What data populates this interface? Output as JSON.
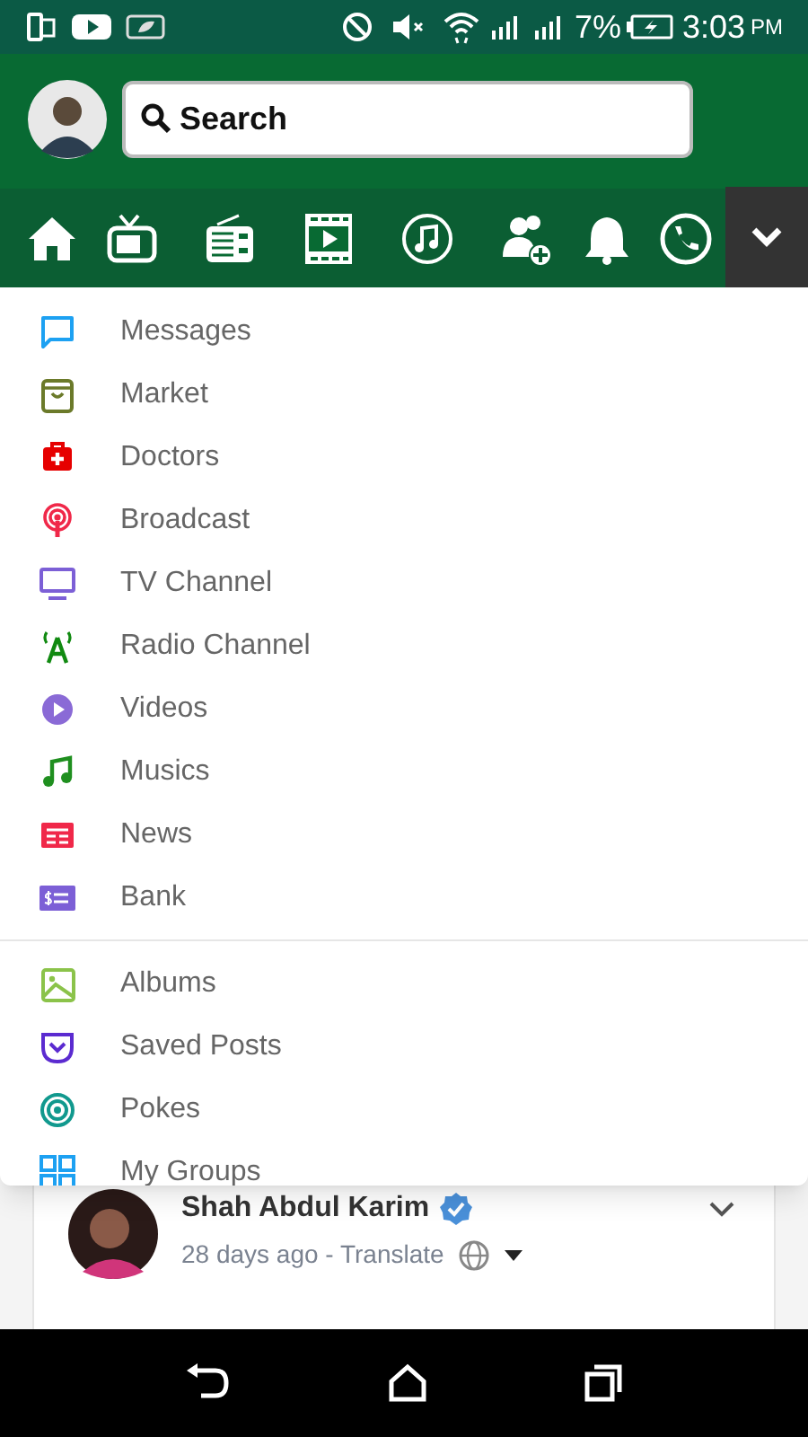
{
  "status_bar": {
    "battery": "7%",
    "time": "3:03",
    "ampm": "PM"
  },
  "search": {
    "placeholder": "Search"
  },
  "menu_toggle": {
    "expanded": true
  },
  "menu": {
    "groups": [
      {
        "items": [
          {
            "label": "Messages"
          },
          {
            "label": "Market"
          },
          {
            "label": "Doctors"
          },
          {
            "label": "Broadcast"
          },
          {
            "label": "TV Channel"
          },
          {
            "label": "Radio Channel"
          },
          {
            "label": "Videos"
          },
          {
            "label": "Musics"
          },
          {
            "label": "News"
          },
          {
            "label": "Bank"
          }
        ]
      },
      {
        "items": [
          {
            "label": "Albums"
          },
          {
            "label": "Saved Posts"
          },
          {
            "label": "Pokes"
          },
          {
            "label": "My Groups"
          }
        ]
      }
    ]
  },
  "post": {
    "author": "Shah Abdul Karim",
    "verified": true,
    "meta": "28 days ago - Translate"
  }
}
